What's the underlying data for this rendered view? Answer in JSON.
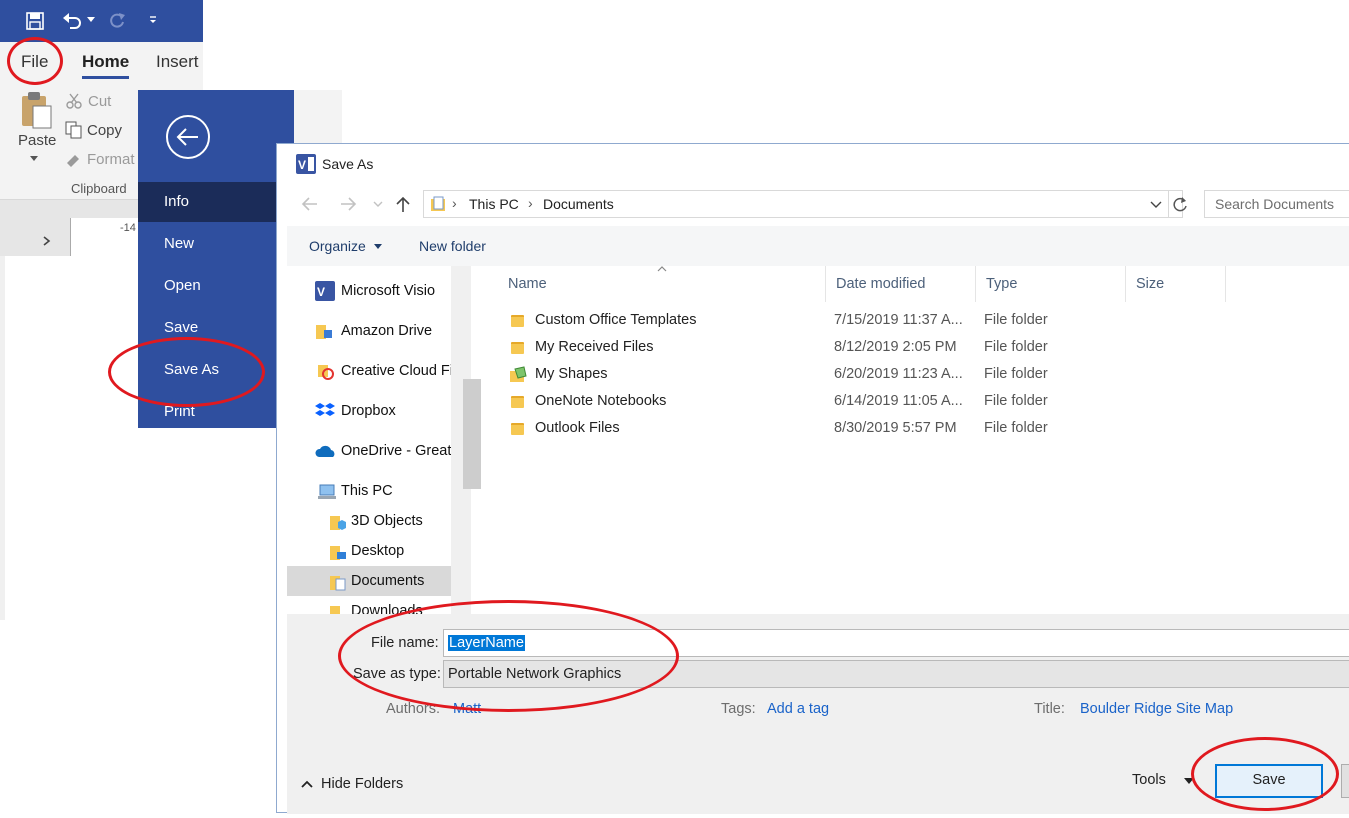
{
  "ribbon": {
    "tabs": [
      "File",
      "Home",
      "Insert"
    ],
    "paste": "Paste",
    "cut": "Cut",
    "copy": "Copy",
    "format": "Format",
    "group": "Clipboard",
    "ruler_number": "-14"
  },
  "backstage": {
    "items": [
      "Info",
      "New",
      "Open",
      "Save",
      "Save As",
      "Print"
    ]
  },
  "dialog": {
    "title": "Save As",
    "address": [
      "This PC",
      "Documents"
    ],
    "search_placeholder": "Search Documents",
    "organize": "Organize",
    "new_folder": "New folder",
    "nav": [
      "Microsoft Visio",
      "Amazon Drive",
      "Creative Cloud Files",
      "Dropbox",
      "OneDrive - Great L",
      "This PC",
      "3D Objects",
      "Desktop",
      "Documents",
      "Downloads"
    ],
    "columns": [
      "Name",
      "Date modified",
      "Type",
      "Size"
    ],
    "files": [
      {
        "name": "Custom Office Templates",
        "date": "7/15/2019 11:37 A...",
        "type": "File folder"
      },
      {
        "name": "My Received Files",
        "date": "8/12/2019 2:05 PM",
        "type": "File folder"
      },
      {
        "name": "My Shapes",
        "date": "6/20/2019 11:23 A...",
        "type": "File folder"
      },
      {
        "name": "OneNote Notebooks",
        "date": "6/14/2019 11:05 A...",
        "type": "File folder"
      },
      {
        "name": "Outlook Files",
        "date": "8/30/2019 5:57 PM",
        "type": "File folder"
      }
    ],
    "file_name_label": "File name:",
    "file_name_value": "LayerName",
    "save_type_label": "Save as type:",
    "save_type_value": "Portable Network Graphics",
    "authors_label": "Authors:",
    "authors_value": "Matt",
    "tags_label": "Tags:",
    "tags_value": "Add a tag",
    "title_label": "Title:",
    "title_value": "Boulder Ridge Site Map",
    "hide_folders": "Hide Folders",
    "tools": "Tools",
    "save": "Save"
  },
  "colors": {
    "accent": "#2f4f9f",
    "annotation": "#e0191f",
    "link": "#1a63c9"
  }
}
